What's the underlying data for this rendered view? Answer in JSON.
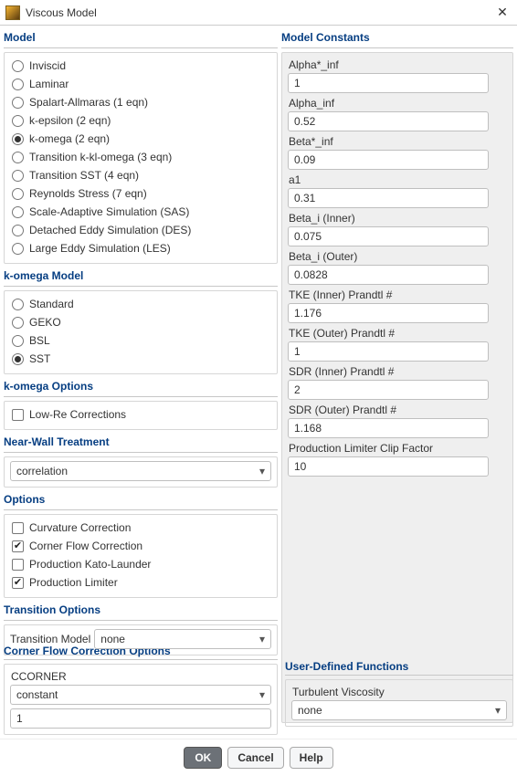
{
  "window": {
    "title": "Viscous Model"
  },
  "sections": {
    "model": "Model",
    "komega_model": "k-omega Model",
    "komega_options": "k-omega Options",
    "near_wall": "Near-Wall Treatment",
    "options": "Options",
    "transition_options": "Transition Options",
    "corner_flow": "Corner Flow Correction Options",
    "model_constants": "Model Constants",
    "udf": "User-Defined Functions"
  },
  "model_radios": [
    {
      "label": "Inviscid",
      "selected": false
    },
    {
      "label": "Laminar",
      "selected": false
    },
    {
      "label": "Spalart-Allmaras (1 eqn)",
      "selected": false
    },
    {
      "label": "k-epsilon (2 eqn)",
      "selected": false
    },
    {
      "label": "k-omega (2 eqn)",
      "selected": true
    },
    {
      "label": "Transition k-kl-omega (3 eqn)",
      "selected": false
    },
    {
      "label": "Transition SST (4 eqn)",
      "selected": false
    },
    {
      "label": "Reynolds Stress (7 eqn)",
      "selected": false
    },
    {
      "label": "Scale-Adaptive Simulation (SAS)",
      "selected": false
    },
    {
      "label": "Detached Eddy Simulation (DES)",
      "selected": false
    },
    {
      "label": "Large Eddy Simulation (LES)",
      "selected": false
    }
  ],
  "komega_radios": [
    {
      "label": "Standard",
      "selected": false
    },
    {
      "label": "GEKO",
      "selected": false
    },
    {
      "label": "BSL",
      "selected": false
    },
    {
      "label": "SST",
      "selected": true
    }
  ],
  "komega_opts": [
    {
      "label": "Low-Re Corrections",
      "checked": false
    }
  ],
  "near_wall_select": "correlation",
  "options_checks": [
    {
      "label": "Curvature Correction",
      "checked": false
    },
    {
      "label": "Corner Flow Correction",
      "checked": true
    },
    {
      "label": "Production Kato-Launder",
      "checked": false
    },
    {
      "label": "Production Limiter",
      "checked": true
    }
  ],
  "transition": {
    "label": "Transition Model",
    "value": "none"
  },
  "corner_flow": {
    "label": "CCORNER",
    "dropdown": "constant",
    "value": "1"
  },
  "constants": [
    {
      "label": "Alpha*_inf",
      "value": "1"
    },
    {
      "label": "Alpha_inf",
      "value": "0.52"
    },
    {
      "label": "Beta*_inf",
      "value": "0.09"
    },
    {
      "label": "a1",
      "value": "0.31"
    },
    {
      "label": "Beta_i (Inner)",
      "value": "0.075"
    },
    {
      "label": "Beta_i (Outer)",
      "value": "0.0828"
    },
    {
      "label": "TKE (Inner) Prandtl #",
      "value": "1.176"
    },
    {
      "label": "TKE (Outer) Prandtl #",
      "value": "1"
    },
    {
      "label": "SDR (Inner) Prandtl #",
      "value": "2"
    },
    {
      "label": "SDR (Outer) Prandtl #",
      "value": "1.168"
    },
    {
      "label": "Production Limiter Clip Factor",
      "value": "10"
    }
  ],
  "udf": {
    "label": "Turbulent Viscosity",
    "value": "none"
  },
  "buttons": {
    "ok": "OK",
    "cancel": "Cancel",
    "help": "Help"
  }
}
